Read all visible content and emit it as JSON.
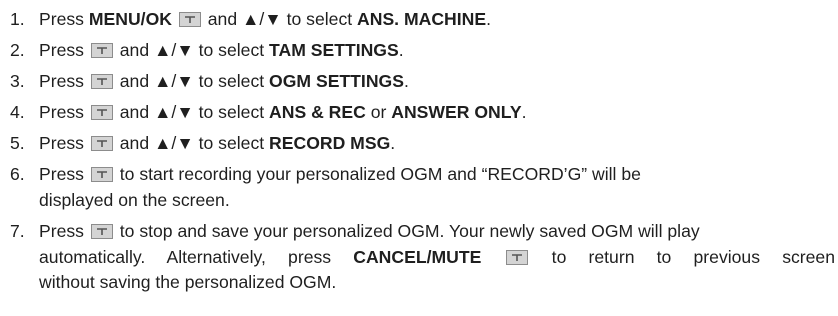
{
  "colors": {
    "text": "#1f1f1f",
    "key_fill": "#d4d4d4",
    "key_border": "#8c8c8c"
  },
  "key_icon": "menu-key-icon",
  "steps": [
    {
      "num": "1.",
      "a": "Press ",
      "b": "MENU/OK",
      "c": " and ",
      "arrows": "▲/▼",
      "d": " to select ",
      "e": "ANS. MACHINE",
      "f": "."
    },
    {
      "num": "2.",
      "a": "Press ",
      "c": " and ",
      "arrows": "▲/▼",
      "d": " to select ",
      "e": "TAM SETTINGS",
      "f": "."
    },
    {
      "num": "3.",
      "a": "Press ",
      "c": " and ",
      "arrows": "▲/▼",
      "d": " to select ",
      "e": "OGM SETTINGS",
      "f": "."
    },
    {
      "num": "4.",
      "a": "Press ",
      "c": " and ",
      "arrows": "▲/▼",
      "d": " to select ",
      "e": "ANS & REC",
      "or": " or ",
      "e2": "ANSWER ONLY",
      "f": "."
    },
    {
      "num": "5.",
      "a": "Press ",
      "c": " and ",
      "arrows": "▲/▼",
      "d": " to select ",
      "e": "RECORD MSG",
      "f": "."
    },
    {
      "num": "6.",
      "a": "Press ",
      "l1": " to start recording your personalized OGM and “RECORD’G” will be",
      "l2": "displayed on the screen."
    },
    {
      "num": "7.",
      "a": "Press ",
      "l1": " to stop and save your personalized OGM. Your newly saved OGM will play",
      "l2": "automatically. Alternatively, press ",
      "b": "CANCEL/MUTE",
      "l2b": " to return to previous screen",
      "l3": "without saving the personalized OGM."
    }
  ]
}
